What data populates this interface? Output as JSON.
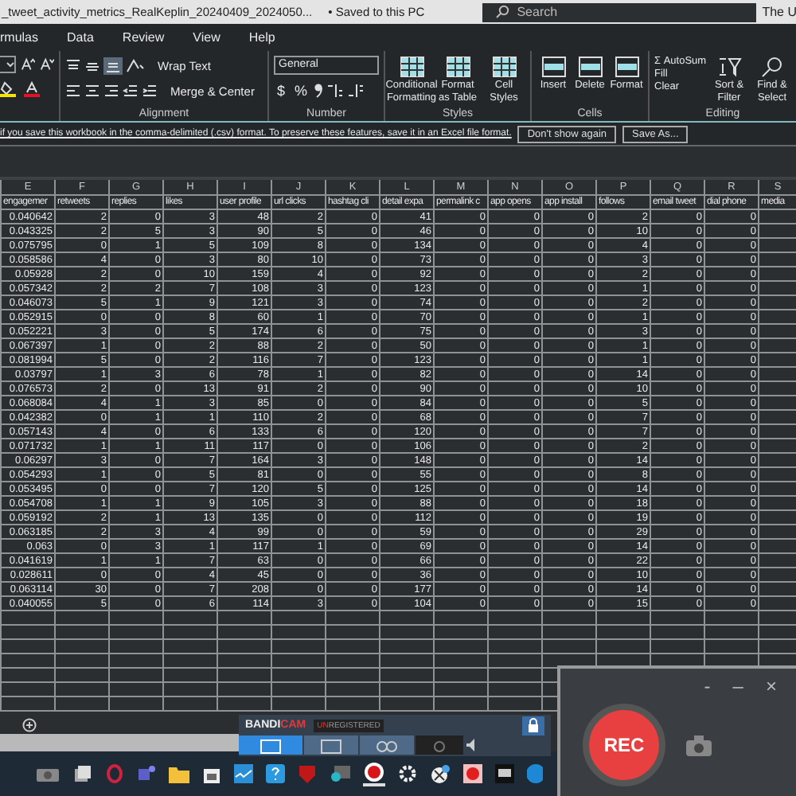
{
  "title_bar": {
    "file_name": "_tweet_activity_metrics_RealKeplin_20240409_2024050...",
    "save_status": "• Saved to this PC",
    "search": {
      "placeholder": "Search"
    },
    "user": "The U"
  },
  "ribbon_tabs": [
    {
      "label": "rmulas",
      "selected": false
    },
    {
      "label": "Data",
      "selected": false
    },
    {
      "label": "Review",
      "selected": false
    },
    {
      "label": "View",
      "selected": false
    },
    {
      "label": "Help",
      "selected": false
    }
  ],
  "alignment": {
    "label": "Alignment",
    "wrap_text": "Wrap Text",
    "merge_center": "Merge & Center"
  },
  "number": {
    "label": "Number",
    "format": "General",
    "currency": "$",
    "percent": "%"
  },
  "styles": {
    "label": "Styles",
    "buttons": [
      "Conditional Formatting",
      "Format as Table",
      "Cell Styles"
    ]
  },
  "cells": {
    "label": "Cells",
    "buttons": [
      "Insert",
      "Delete",
      "Format"
    ]
  },
  "editing": {
    "label": "Editing",
    "autosum_icon": "Σ",
    "autosum": "AutoSum",
    "fill": "Fill",
    "clear": "Clear",
    "sort": "Sort & Filter",
    "find": "Find & Select"
  },
  "info_bar": {
    "message": "if you save this workbook in the comma-delimited (.csv) format. To preserve these features, save it in an Excel file format.",
    "buttons": [
      "Don't show again",
      "Save As..."
    ]
  },
  "sheet": {
    "column_letters": [
      "E",
      "F",
      "G",
      "H",
      "I",
      "J",
      "K",
      "L",
      "M",
      "N",
      "O",
      "P",
      "Q",
      "R",
      "S"
    ],
    "headers": [
      "engagemer",
      "retweets",
      "replies",
      "likes",
      "user profile",
      "url clicks",
      "hashtag cli",
      "detail expa",
      "permalink c",
      "app opens",
      "app install",
      "follows",
      "email tweet",
      "dial phone",
      "media"
    ],
    "rows": [
      [
        "0.040642",
        "2",
        "0",
        "3",
        "48",
        "2",
        "0",
        "41",
        "0",
        "0",
        "0",
        "2",
        "0",
        "0"
      ],
      [
        "0.043325",
        "2",
        "5",
        "3",
        "90",
        "5",
        "0",
        "46",
        "0",
        "0",
        "0",
        "10",
        "0",
        "0"
      ],
      [
        "0.075795",
        "0",
        "1",
        "5",
        "109",
        "8",
        "0",
        "134",
        "0",
        "0",
        "0",
        "4",
        "0",
        "0"
      ],
      [
        "0.058586",
        "4",
        "0",
        "3",
        "80",
        "10",
        "0",
        "73",
        "0",
        "0",
        "0",
        "3",
        "0",
        "0"
      ],
      [
        "0.05928",
        "2",
        "0",
        "10",
        "159",
        "4",
        "0",
        "92",
        "0",
        "0",
        "0",
        "2",
        "0",
        "0"
      ],
      [
        "0.057342",
        "2",
        "2",
        "7",
        "108",
        "3",
        "0",
        "123",
        "0",
        "0",
        "0",
        "1",
        "0",
        "0"
      ],
      [
        "0.046073",
        "5",
        "1",
        "9",
        "121",
        "3",
        "0",
        "74",
        "0",
        "0",
        "0",
        "2",
        "0",
        "0"
      ],
      [
        "0.052915",
        "0",
        "0",
        "8",
        "60",
        "1",
        "0",
        "70",
        "0",
        "0",
        "0",
        "1",
        "0",
        "0"
      ],
      [
        "0.052221",
        "3",
        "0",
        "5",
        "174",
        "6",
        "0",
        "75",
        "0",
        "0",
        "0",
        "3",
        "0",
        "0"
      ],
      [
        "0.067397",
        "1",
        "0",
        "2",
        "88",
        "2",
        "0",
        "50",
        "0",
        "0",
        "0",
        "1",
        "0",
        "0"
      ],
      [
        "0.081994",
        "5",
        "0",
        "2",
        "116",
        "7",
        "0",
        "123",
        "0",
        "0",
        "0",
        "1",
        "0",
        "0"
      ],
      [
        "0.03797",
        "1",
        "3",
        "6",
        "78",
        "1",
        "0",
        "82",
        "0",
        "0",
        "0",
        "14",
        "0",
        "0"
      ],
      [
        "0.076573",
        "2",
        "0",
        "13",
        "91",
        "2",
        "0",
        "90",
        "0",
        "0",
        "0",
        "10",
        "0",
        "0"
      ],
      [
        "0.068084",
        "4",
        "1",
        "3",
        "85",
        "0",
        "0",
        "84",
        "0",
        "0",
        "0",
        "5",
        "0",
        "0"
      ],
      [
        "0.042382",
        "0",
        "1",
        "1",
        "110",
        "2",
        "0",
        "68",
        "0",
        "0",
        "0",
        "7",
        "0",
        "0"
      ],
      [
        "0.057143",
        "4",
        "0",
        "6",
        "133",
        "6",
        "0",
        "120",
        "0",
        "0",
        "0",
        "7",
        "0",
        "0"
      ],
      [
        "0.071732",
        "1",
        "1",
        "11",
        "117",
        "0",
        "0",
        "106",
        "0",
        "0",
        "0",
        "2",
        "0",
        "0"
      ],
      [
        "0.06297",
        "3",
        "0",
        "7",
        "164",
        "3",
        "0",
        "148",
        "0",
        "0",
        "0",
        "14",
        "0",
        "0"
      ],
      [
        "0.054293",
        "1",
        "0",
        "5",
        "81",
        "0",
        "0",
        "55",
        "0",
        "0",
        "0",
        "8",
        "0",
        "0"
      ],
      [
        "0.053495",
        "0",
        "0",
        "7",
        "120",
        "5",
        "0",
        "125",
        "0",
        "0",
        "0",
        "14",
        "0",
        "0"
      ],
      [
        "0.054708",
        "1",
        "1",
        "9",
        "105",
        "3",
        "0",
        "88",
        "0",
        "0",
        "0",
        "18",
        "0",
        "0"
      ],
      [
        "0.059192",
        "2",
        "1",
        "13",
        "135",
        "0",
        "0",
        "112",
        "0",
        "0",
        "0",
        "19",
        "0",
        "0"
      ],
      [
        "0.063185",
        "2",
        "3",
        "4",
        "99",
        "0",
        "0",
        "59",
        "0",
        "0",
        "0",
        "29",
        "0",
        "0"
      ],
      [
        "0.063",
        "0",
        "3",
        "1",
        "117",
        "1",
        "0",
        "69",
        "0",
        "0",
        "0",
        "14",
        "0",
        "0"
      ],
      [
        "0.041619",
        "1",
        "1",
        "7",
        "63",
        "0",
        "0",
        "66",
        "0",
        "0",
        "0",
        "22",
        "0",
        "0"
      ],
      [
        "0.028611",
        "0",
        "0",
        "4",
        "45",
        "0",
        "0",
        "36",
        "0",
        "0",
        "0",
        "10",
        "0",
        "0"
      ],
      [
        "0.063114",
        "30",
        "0",
        "7",
        "208",
        "0",
        "0",
        "177",
        "0",
        "0",
        "0",
        "14",
        "0",
        "0"
      ],
      [
        "0.040055",
        "5",
        "0",
        "6",
        "114",
        "3",
        "0",
        "104",
        "0",
        "0",
        "0",
        "15",
        "0",
        "0"
      ]
    ]
  },
  "bandicam": {
    "brand_main": "BANDI",
    "brand_accent": "CAM",
    "badge_accent": "UN",
    "badge_rest": "REGISTERED",
    "dash": "-",
    "minimize": "–",
    "close": "×",
    "rec": "REC"
  }
}
